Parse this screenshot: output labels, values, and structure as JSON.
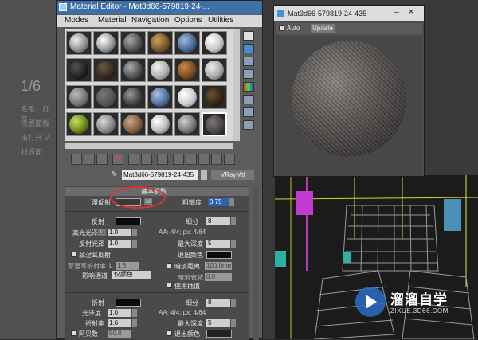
{
  "background_doc": {
    "heading": "1/6",
    "lines": [
      "毛毛：打开",
      "设置面板",
      "击打开 V",
      "材质面...："
    ]
  },
  "material_editor": {
    "title": "Material Editor - Mat3d66-579819-24-...",
    "menu": [
      "Modes",
      "Material",
      "Navigation",
      "Options",
      "Utilities"
    ],
    "material_name": "Mat3d66-579819-24-435",
    "material_type": "VRayMtl",
    "rollout_title": "基本参数",
    "rollout_toggle": "-",
    "diffuse": {
      "label": "漫反射",
      "map_button": "M",
      "roughness_label": "粗糙度",
      "roughness_value": "0.75"
    },
    "reflection": {
      "label": "反射",
      "subdiv_label": "细分",
      "subdiv_value": "8",
      "hilight_gloss_label": "高光光泽",
      "hilight_gloss_value": "1.0",
      "aa_text": "AA: 4/4; px: 4/64",
      "refl_gloss_label": "反射光泽",
      "refl_gloss_value": "1.0",
      "max_depth_label": "最大深度",
      "max_depth_value": "5",
      "fresnel_label": "菲涅耳反射",
      "exit_color_label": "退出颜色",
      "fresnel_ior_label": "菲涅耳折射率",
      "fresnel_ior_l": "L",
      "fresnel_ior_value": "1.6",
      "dim_distance_label": "暗淡距离",
      "dim_distance_value": "100.0mm",
      "dim_falloff_label": "暗淡衰减",
      "dim_falloff_value": "0.0",
      "affect_channels_label": "影响通道",
      "affect_channels_value": "仅颜色",
      "use_interp_label": "使用插值"
    },
    "refraction": {
      "label": "折射",
      "subdiv_label": "细分",
      "subdiv_value": "8",
      "gloss_label": "光泽度",
      "gloss_value": "1.0",
      "aa_text": "AA: 4/4; px: 4/64",
      "ior_label": "折射率",
      "ior_value": "1.6",
      "max_depth_label": "最大深度",
      "max_depth_value": "5",
      "abbe_label": "阿贝数",
      "abbe_value": "50.0",
      "exit_color_label": "退出颜色"
    }
  },
  "preview_window": {
    "title": "Mat3d66-579819-24-435",
    "auto_label": "Auto",
    "update_label": "Update",
    "minimize": "–",
    "close": "✕"
  },
  "watermark": {
    "title": "溜溜自学",
    "url": "ZIXUE.3D66.COM"
  },
  "colors": {
    "titlebar": "#3d6fa8",
    "highlight": "#dd3333",
    "accent": "#2b6cc4"
  }
}
